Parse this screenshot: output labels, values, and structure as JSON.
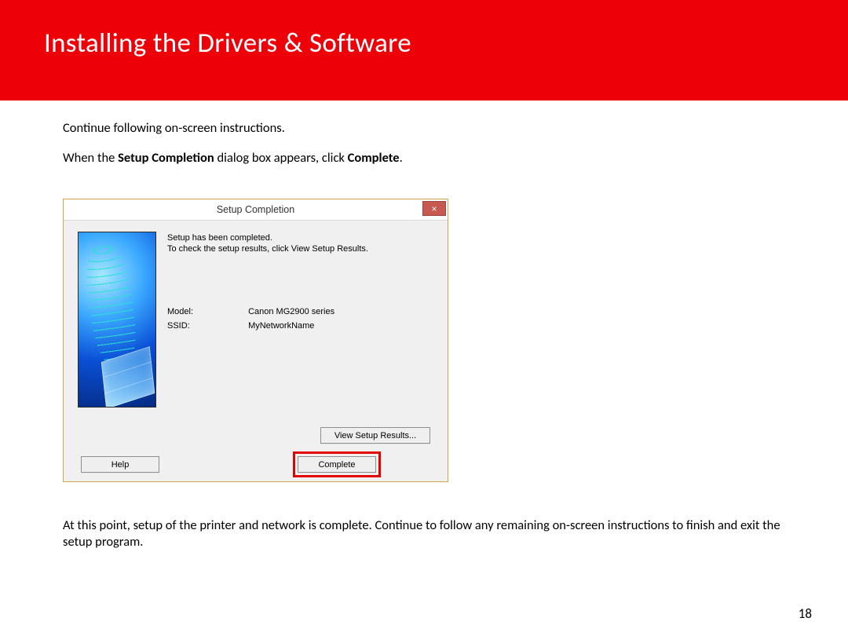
{
  "header": {
    "title": "Installing  the Drivers & Software"
  },
  "texts": {
    "p1": "Continue following on-screen instructions.",
    "p2_a": "When the  ",
    "p2_b": "Setup Completion",
    "p2_c": " dialog box appears, click ",
    "p2_d": "Complete",
    "p2_e": ".",
    "p3": "At this point, setup of the printer and network is complete.  Continue to follow any remaining on-screen instructions to finish and exit the setup program."
  },
  "dialog": {
    "title": "Setup Completion",
    "close_glyph": "×",
    "msg_line1": "Setup has been completed.",
    "msg_line2": "To check the setup results, click View Setup Results.",
    "model_label": "Model:",
    "model_value": "Canon MG2900 series",
    "ssid_label": "SSID:",
    "ssid_value": "MyNetworkName",
    "buttons": {
      "view": "View Setup Results...",
      "help": "Help",
      "complete": "Complete"
    }
  },
  "page_number": "18"
}
